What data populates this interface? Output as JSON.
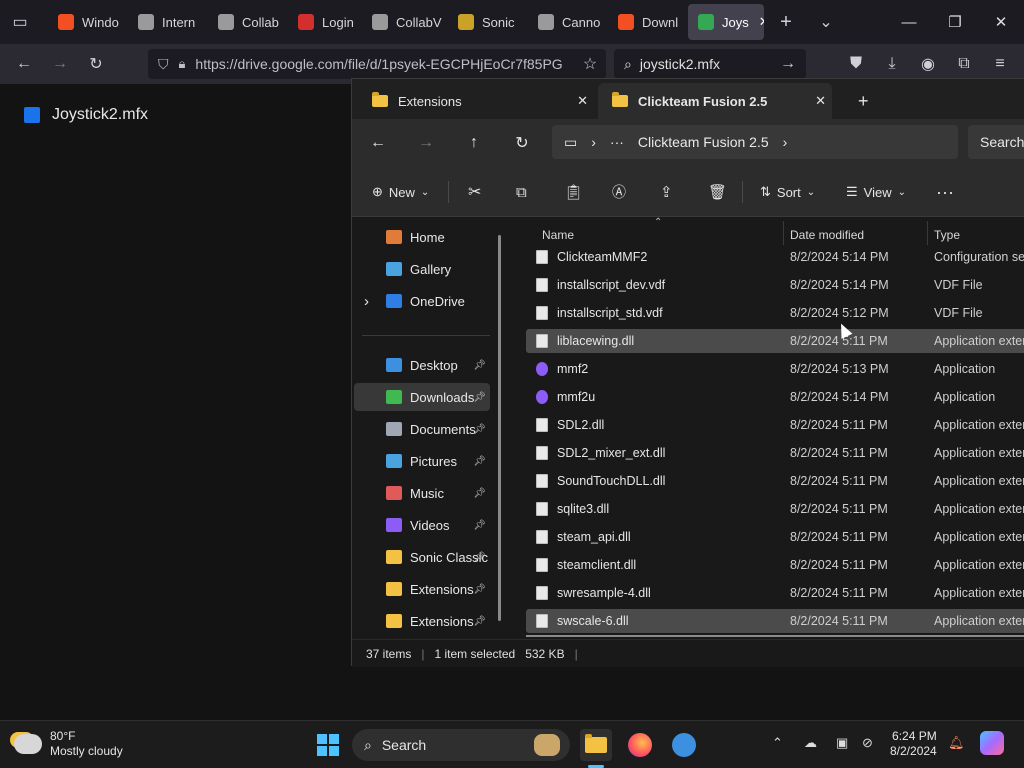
{
  "browser": {
    "tabs": [
      {
        "label": "Windo",
        "color": "#f25022"
      },
      {
        "label": "Intern",
        "color": "#9a9a9a"
      },
      {
        "label": "Collab",
        "color": "#9a9a9a"
      },
      {
        "label": "Login",
        "color": "#d32f2f"
      },
      {
        "label": "CollabVM",
        "color": "#9a9a9a"
      },
      {
        "label": "Sonic",
        "color": "#c9a227"
      },
      {
        "label": "Canno",
        "color": "#9a9a9a"
      },
      {
        "label": "Downl",
        "color": "#f25022"
      },
      {
        "label": "Joys",
        "color": "#34a853"
      }
    ],
    "url": "https://drive.google.com/file/d/1psyek-EGCPHjEoCr7f85PG",
    "search_value": "joystick2.mfx"
  },
  "page": {
    "file_title": "Joystick2.mfx"
  },
  "explorer": {
    "tabs": [
      {
        "label": "Extensions"
      },
      {
        "label": "Clickteam Fusion 2.5"
      }
    ],
    "breadcrumb": {
      "current": "Clickteam Fusion 2.5"
    },
    "search_placeholder": "Search",
    "commands": {
      "new": "New",
      "sort": "Sort",
      "view": "View"
    },
    "nav": [
      {
        "label": "Home",
        "pinned": false,
        "color": "#e07b39"
      },
      {
        "label": "Gallery",
        "pinned": false,
        "color": "#4aa3df"
      },
      {
        "label": "OneDrive",
        "pinned": false,
        "color": "#2f7ee6"
      },
      {
        "label": "Desktop",
        "pinned": true,
        "color": "#3d8fe0"
      },
      {
        "label": "Downloads",
        "pinned": true,
        "color": "#3fb950"
      },
      {
        "label": "Documents",
        "pinned": true,
        "color": "#9ea7b3"
      },
      {
        "label": "Pictures",
        "pinned": true,
        "color": "#4aa3df"
      },
      {
        "label": "Music",
        "pinned": true,
        "color": "#e05a5a"
      },
      {
        "label": "Videos",
        "pinned": true,
        "color": "#8b5cf6"
      },
      {
        "label": "Sonic Classic",
        "pinned": true,
        "color": "#f3c242"
      },
      {
        "label": "Extensions",
        "pinned": true,
        "color": "#f3c242"
      },
      {
        "label": "Extensions",
        "pinned": true,
        "color": "#f3c242"
      }
    ],
    "columns": {
      "name": "Name",
      "date": "Date modified",
      "type": "Type"
    },
    "files": [
      {
        "name": "ClickteamMMF2",
        "date": "8/2/2024 5:14 PM",
        "type": "Configuration set"
      },
      {
        "name": "installscript_dev.vdf",
        "date": "8/2/2024 5:14 PM",
        "type": "VDF File"
      },
      {
        "name": "installscript_std.vdf",
        "date": "8/2/2024 5:12 PM",
        "type": "VDF File"
      },
      {
        "name": "liblacewing.dll",
        "date": "8/2/2024 5:11 PM",
        "type": "Application exten"
      },
      {
        "name": "mmf2",
        "date": "8/2/2024 5:13 PM",
        "type": "Application"
      },
      {
        "name": "mmf2u",
        "date": "8/2/2024 5:14 PM",
        "type": "Application"
      },
      {
        "name": "SDL2.dll",
        "date": "8/2/2024 5:11 PM",
        "type": "Application exten"
      },
      {
        "name": "SDL2_mixer_ext.dll",
        "date": "8/2/2024 5:11 PM",
        "type": "Application exten"
      },
      {
        "name": "SoundTouchDLL.dll",
        "date": "8/2/2024 5:11 PM",
        "type": "Application exten"
      },
      {
        "name": "sqlite3.dll",
        "date": "8/2/2024 5:11 PM",
        "type": "Application exten"
      },
      {
        "name": "steam_api.dll",
        "date": "8/2/2024 5:11 PM",
        "type": "Application exten"
      },
      {
        "name": "steamclient.dll",
        "date": "8/2/2024 5:11 PM",
        "type": "Application exten"
      },
      {
        "name": "swresample-4.dll",
        "date": "8/2/2024 5:11 PM",
        "type": "Application exten"
      },
      {
        "name": "swscale-6.dll",
        "date": "8/2/2024 5:11 PM",
        "type": "Application exten"
      }
    ],
    "status": {
      "count": "37 items",
      "selected": "1 item selected",
      "size": "532 KB"
    }
  },
  "taskbar": {
    "weather_temp": "80°F",
    "weather_desc": "Mostly cloudy",
    "search_label": "Search",
    "time": "6:24 PM",
    "date": "8/2/2024"
  }
}
